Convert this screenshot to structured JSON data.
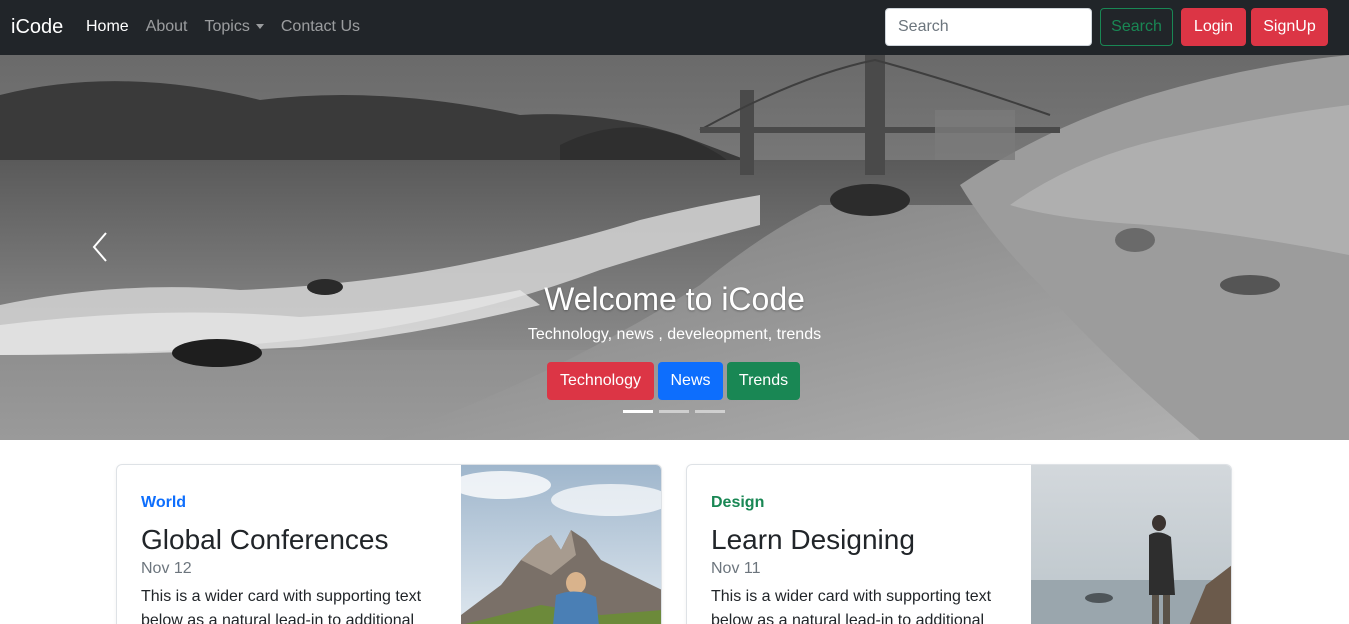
{
  "navbar": {
    "brand": "iCode",
    "links": [
      {
        "label": "Home",
        "active": true
      },
      {
        "label": "About",
        "active": false
      },
      {
        "label": "Topics",
        "active": false,
        "dropdown": true
      },
      {
        "label": "Contact Us",
        "active": false
      }
    ],
    "search_placeholder": "Search",
    "search_button": "Search",
    "login_button": "Login",
    "signup_button": "SignUp"
  },
  "carousel": {
    "title": "Welcome to iCode",
    "subtitle": "Technology, news , develeopment, trends",
    "buttons": [
      {
        "label": "Technology",
        "color": "#dc3545"
      },
      {
        "label": "News",
        "color": "#0d6efd"
      },
      {
        "label": "Trends",
        "color": "#198754"
      }
    ],
    "indicator_count": 3,
    "active_indicator": 0,
    "prev_icon": "chevron-left-icon"
  },
  "cards": [
    {
      "category": "World",
      "category_color": "#0d6efd",
      "title": "Global Conferences",
      "date": "Nov 12",
      "text": "This is a wider card with supporting text below as a natural lead-in to additional"
    },
    {
      "category": "Design",
      "category_color": "#198754",
      "title": "Learn Designing",
      "date": "Nov 11",
      "text": "This is a wider card with supporting text below as a natural lead-in to additional"
    }
  ],
  "colors": {
    "navbar_bg": "#212529",
    "danger": "#dc3545",
    "primary": "#0d6efd",
    "success": "#198754"
  }
}
